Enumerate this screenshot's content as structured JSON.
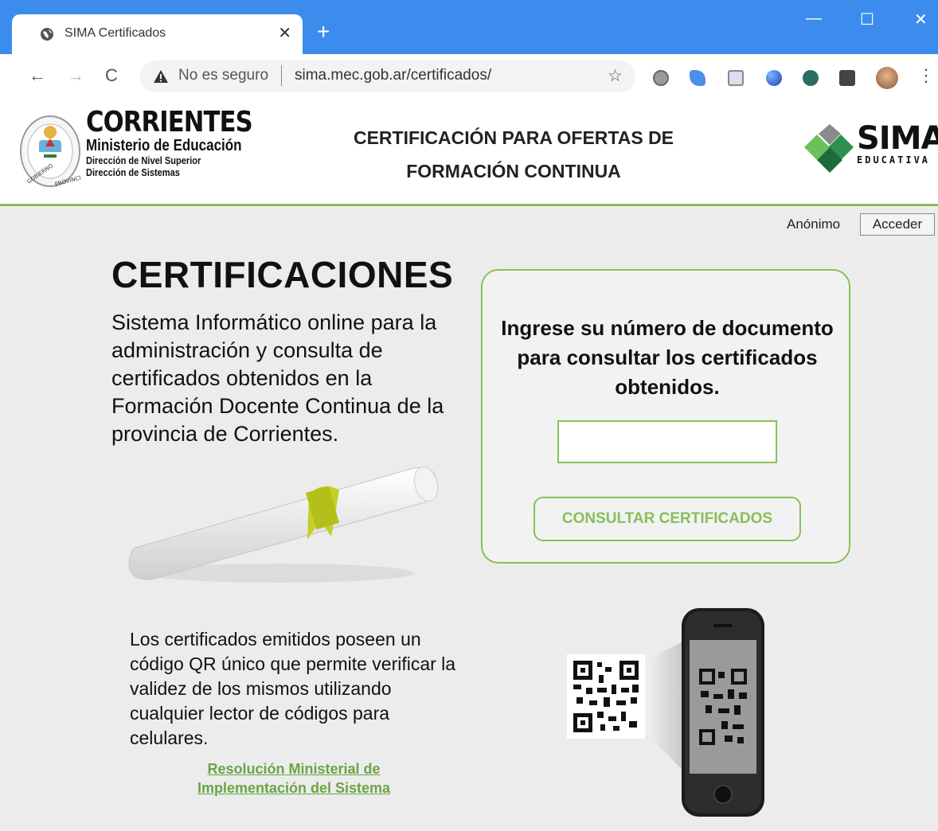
{
  "browser": {
    "tab_title": "SIMA Certificados",
    "tab_close": "✕",
    "new_tab": "+",
    "window_controls": {
      "minimize": "—",
      "maximize": "☐",
      "close": "✕"
    },
    "nav": {
      "back": "←",
      "forward": "→",
      "reload": "C"
    },
    "not_secure": "No es seguro",
    "url": "sima.mec.gob.ar/certificados/",
    "bookmark_icon": "☆",
    "menu_icon": "⋮"
  },
  "header": {
    "province": "CORRIENTES",
    "ministry": "Ministerio de Educación",
    "direction1": "Dirección de Nivel Superior",
    "direction2": "Dirección de Sistemas",
    "title_line1": "CERTIFICACIÓN PARA OFERTAS DE",
    "title_line2": "FORMACIÓN CONTINUA",
    "sima": "SIMA",
    "sima_sub": "EDUCATIVA",
    "seal_text": "GOBIERNO PROVINCIAL"
  },
  "userbar": {
    "user": "Anónimo",
    "login_label": "Acceder"
  },
  "main": {
    "heading": "CERTIFICACIONES",
    "intro": "Sistema Informático online para la administración y consulta de certificados obtenidos en la Formación Docente Continua de la provincia de Corrientes.",
    "prompt": "Ingrese su número de documento para consultar los certificados obtenidos.",
    "document_value": "",
    "button_label": "CONSULTAR CERTIFICADOS",
    "qr_info": "Los certificados emitidos poseen un código QR único que permite verificar la validez de los mismos utilizando cualquier lector de códigos para celulares.",
    "resolution_link": "Resolución Ministerial de Implementación del Sistema"
  },
  "colors": {
    "accent": "#86c05a",
    "link": "#6aa544",
    "chrome_blue": "#3b8ced"
  }
}
